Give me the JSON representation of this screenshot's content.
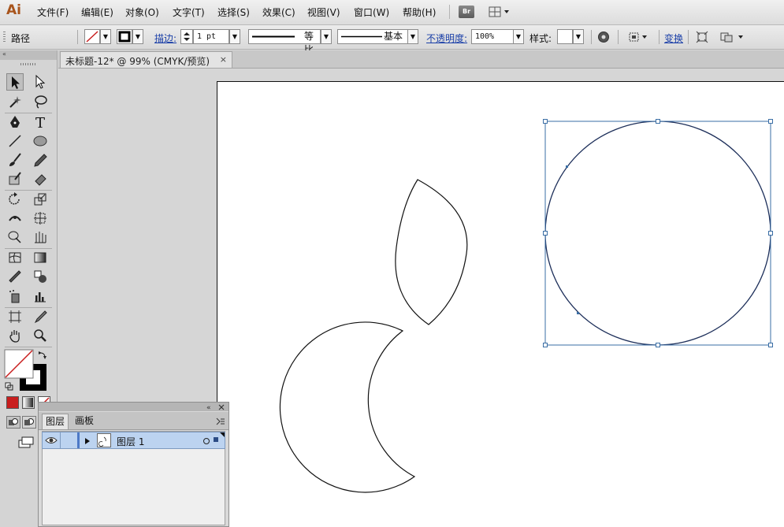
{
  "app": {
    "logo": "Ai"
  },
  "menu": {
    "items": [
      {
        "label": "文件(F)"
      },
      {
        "label": "编辑(E)"
      },
      {
        "label": "对象(O)"
      },
      {
        "label": "文字(T)"
      },
      {
        "label": "选择(S)"
      },
      {
        "label": "效果(C)"
      },
      {
        "label": "视图(V)"
      },
      {
        "label": "窗口(W)"
      },
      {
        "label": "帮助(H)"
      }
    ],
    "bridge_label": "Br"
  },
  "control": {
    "selection_type": "路径",
    "stroke_label": "描边:",
    "stroke_weight": "1 pt",
    "profile_label": "等比",
    "brush_label": "基本",
    "opacity_label": "不透明度:",
    "opacity_value": "100%",
    "style_label": "样式:",
    "transform_label": "变换"
  },
  "document": {
    "tab_title": "未标题-12* @ 99% (CMYK/预览)",
    "close_glyph": "×"
  },
  "layers_panel": {
    "tabs": [
      {
        "label": "图层"
      },
      {
        "label": "画板"
      }
    ],
    "layer_name": "图层 1"
  },
  "colors": {
    "selection": "#3a6ea5",
    "accent_red": "#c81e1e",
    "layer_highlight": "#bcd3f0"
  },
  "icons": [
    "eye-icon",
    "triangle-icon",
    "target-icon",
    "grip-icon"
  ]
}
